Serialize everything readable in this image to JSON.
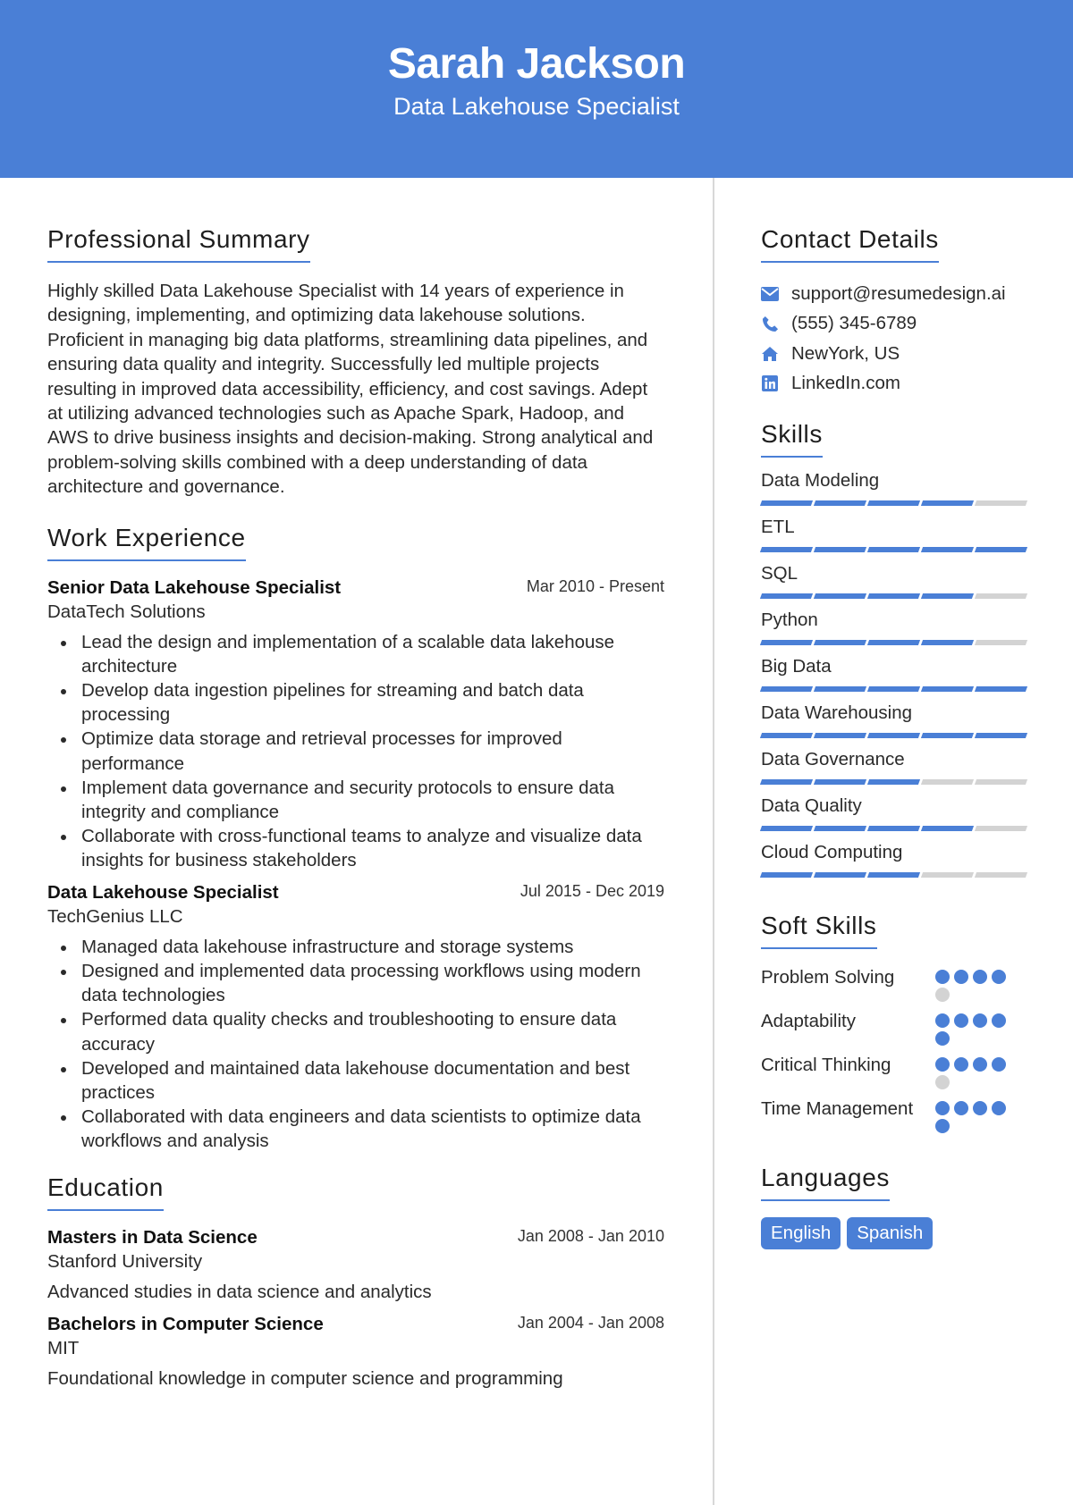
{
  "header": {
    "name": "Sarah Jackson",
    "title": "Data Lakehouse Specialist"
  },
  "colors": {
    "accent": "#4a7fd6",
    "inactive": "#d3d3d3",
    "divider": "#d8d8d8"
  },
  "summary": {
    "heading": "Professional Summary",
    "text": "Highly skilled Data Lakehouse Specialist with 14 years of experience in designing, implementing, and optimizing data lakehouse solutions. Proficient in managing big data platforms, streamlining data pipelines, and ensuring data quality and integrity. Successfully led multiple projects resulting in improved data accessibility, efficiency, and cost savings. Adept at utilizing advanced technologies such as Apache Spark, Hadoop, and AWS to drive business insights and decision-making. Strong analytical and problem-solving skills combined with a deep understanding of data architecture and governance."
  },
  "experience": {
    "heading": "Work Experience",
    "jobs": [
      {
        "title": "Senior Data Lakehouse Specialist",
        "company": "DataTech Solutions",
        "dates": "Mar 2010 - Present",
        "bullets": [
          "Lead the design and implementation of a scalable data lakehouse architecture",
          "Develop data ingestion pipelines for streaming and batch data processing",
          "Optimize data storage and retrieval processes for improved performance",
          "Implement data governance and security protocols to ensure data integrity and compliance",
          "Collaborate with cross-functional teams to analyze and visualize data insights for business stakeholders"
        ]
      },
      {
        "title": "Data Lakehouse Specialist",
        "company": "TechGenius LLC",
        "dates": "Jul 2015 - Dec 2019",
        "bullets": [
          "Managed data lakehouse infrastructure and storage systems",
          "Designed and implemented data processing workflows using modern data technologies",
          "Performed data quality checks and troubleshooting to ensure data accuracy",
          "Developed and maintained data lakehouse documentation and best practices",
          "Collaborated with data engineers and data scientists to optimize data workflows and analysis"
        ]
      }
    ]
  },
  "education": {
    "heading": "Education",
    "items": [
      {
        "degree": "Masters in Data Science",
        "school": "Stanford University",
        "dates": "Jan 2008 - Jan 2010",
        "description": "Advanced studies in data science and analytics"
      },
      {
        "degree": "Bachelors in Computer Science",
        "school": "MIT",
        "dates": "Jan 2004 - Jan 2008",
        "description": "Foundational knowledge in computer science and programming"
      }
    ]
  },
  "contact": {
    "heading": "Contact Details",
    "items": [
      {
        "icon": "envelope-icon",
        "text": "support@resumedesign.ai"
      },
      {
        "icon": "phone-icon",
        "text": "(555) 345-6789"
      },
      {
        "icon": "home-icon",
        "text": "NewYork, US"
      },
      {
        "icon": "linkedin-icon",
        "text": "LinkedIn.com"
      }
    ]
  },
  "skills": {
    "heading": "Skills",
    "max": 5,
    "items": [
      {
        "name": "Data Modeling",
        "level": 4
      },
      {
        "name": "ETL",
        "level": 5
      },
      {
        "name": "SQL",
        "level": 4
      },
      {
        "name": "Python",
        "level": 4
      },
      {
        "name": "Big Data",
        "level": 5
      },
      {
        "name": "Data Warehousing",
        "level": 5
      },
      {
        "name": "Data Governance",
        "level": 3
      },
      {
        "name": "Data Quality",
        "level": 4
      },
      {
        "name": "Cloud Computing",
        "level": 3
      }
    ]
  },
  "soft_skills": {
    "heading": "Soft Skills",
    "max": 5,
    "items": [
      {
        "name": "Problem Solving",
        "level": 4
      },
      {
        "name": "Adaptability",
        "level": 5
      },
      {
        "name": "Critical Thinking",
        "level": 4
      },
      {
        "name": "Time Management",
        "level": 5
      }
    ]
  },
  "languages": {
    "heading": "Languages",
    "items": [
      "English",
      "Spanish"
    ]
  }
}
